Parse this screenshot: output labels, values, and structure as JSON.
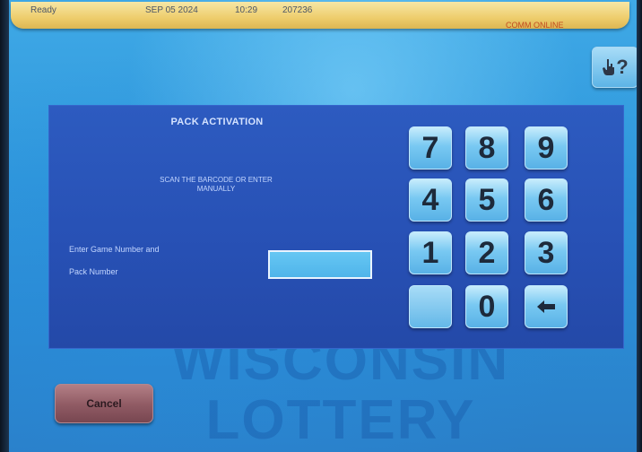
{
  "status": {
    "state": "Ready",
    "date": "SEP 05 2024",
    "time": "10:29",
    "code": "207236",
    "comm": "COMM ONLINE"
  },
  "help": {
    "icon": "hand-pointer-question-icon",
    "label": "?"
  },
  "watermark": {
    "line1": "WISCONSIN",
    "line2": "LOTTERY"
  },
  "panel": {
    "title": "PACK ACTIVATION",
    "instruction": "SCAN THE BARCODE OR ENTER MANUALLY",
    "label_line1": "Enter Game Number and",
    "label_line2": "Pack Number",
    "input_value": ""
  },
  "keypad": {
    "k7": "7",
    "k8": "8",
    "k9": "9",
    "k4": "4",
    "k5": "5",
    "k6": "6",
    "k1": "1",
    "k2": "2",
    "k3": "3",
    "k0": "0",
    "backspace_icon": "arrow-left-icon"
  },
  "cancel_label": "Cancel",
  "colors": {
    "status_bar": "#eecd6c",
    "panel": "#2750b4",
    "key": "#79c9f2",
    "cancel": "#8f5a63"
  }
}
